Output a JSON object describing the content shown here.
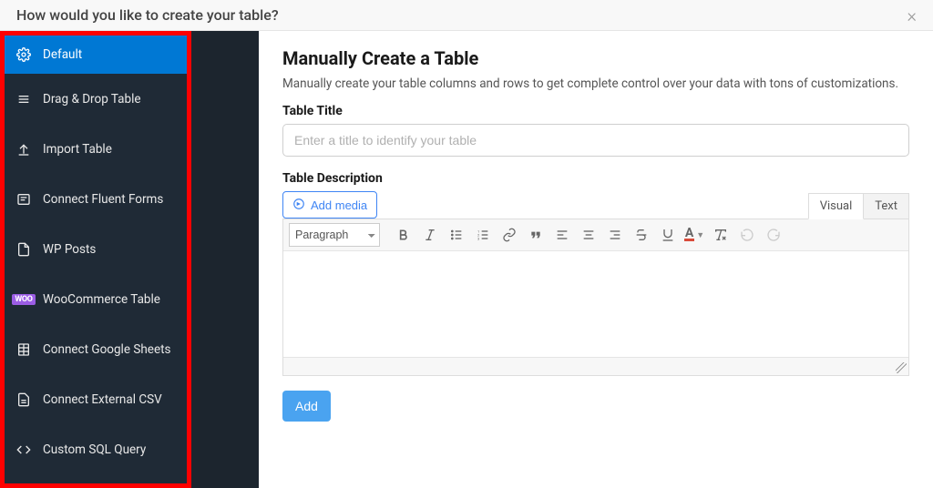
{
  "header": {
    "title": "How would you like to create your table?"
  },
  "sidebar": {
    "items": [
      {
        "label": "Default"
      },
      {
        "label": "Drag & Drop Table"
      },
      {
        "label": "Import Table"
      },
      {
        "label": "Connect Fluent Forms"
      },
      {
        "label": "WP Posts"
      },
      {
        "label": "WooCommerce Table"
      },
      {
        "label": "Connect Google Sheets"
      },
      {
        "label": "Connect External CSV"
      },
      {
        "label": "Custom SQL Query"
      }
    ],
    "woo_badge": "WOO"
  },
  "main": {
    "heading": "Manually Create a Table",
    "description": "Manually create your table columns and rows to get complete control over your data with tons of customizations.",
    "title_label": "Table Title",
    "title_placeholder": "Enter a title to identify your table",
    "desc_label": "Table Description",
    "add_media_label": "Add media",
    "tabs": {
      "visual": "Visual",
      "text": "Text"
    },
    "format_select": "Paragraph",
    "add_btn": "Add"
  }
}
